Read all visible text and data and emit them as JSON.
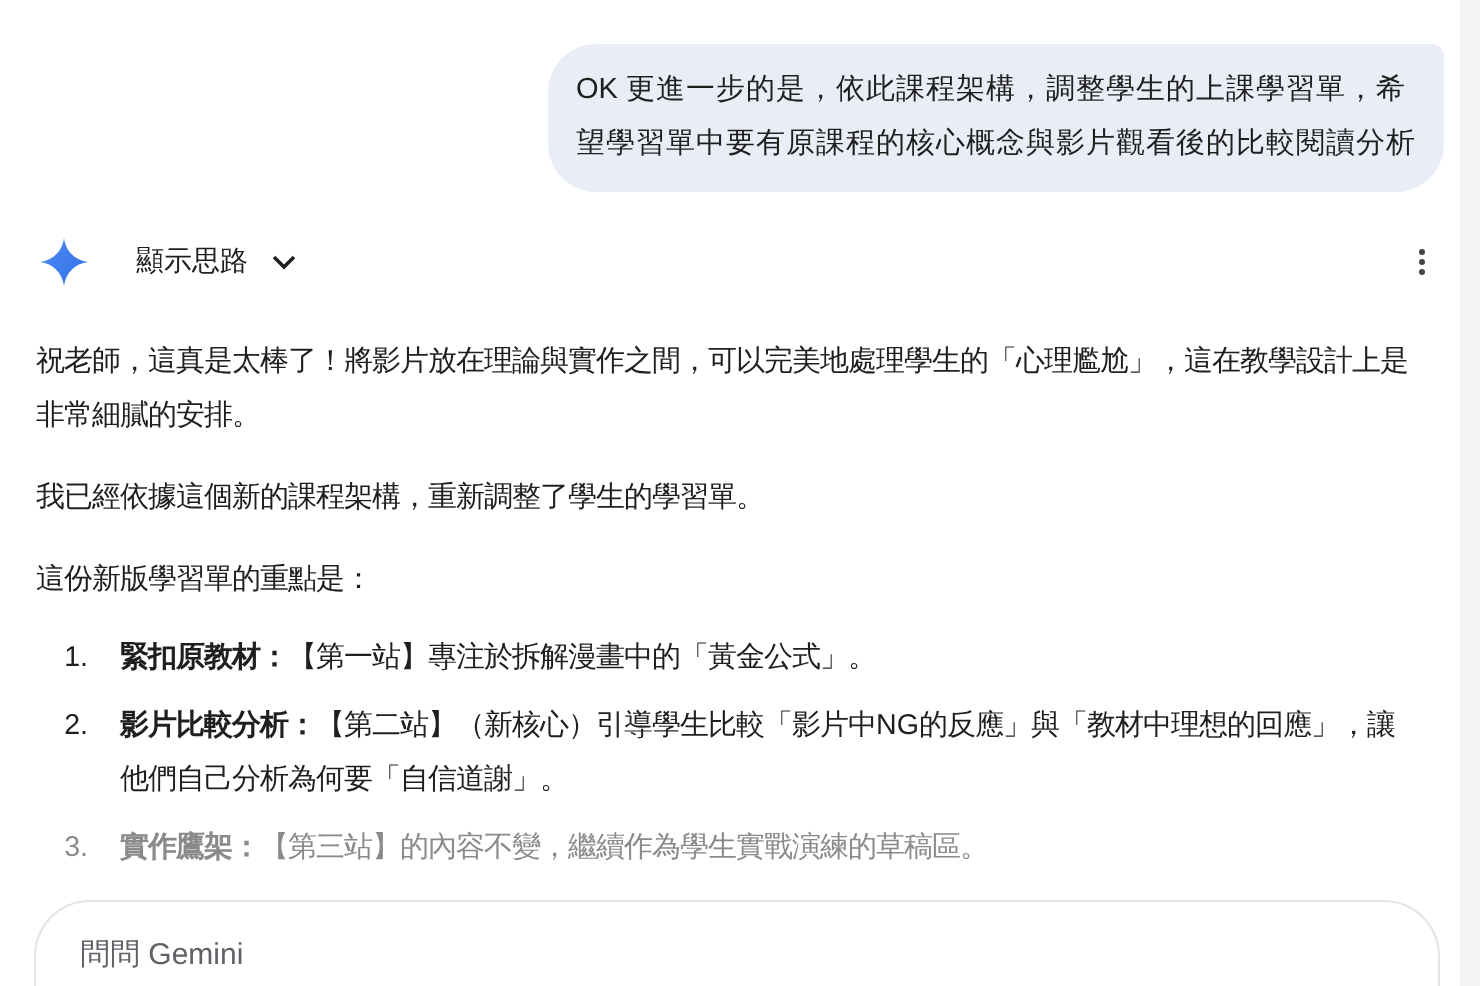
{
  "user_message": "OK 更進一步的是，依此課程架構，調整學生的上課學習單，希望學習單中要有原課程的核心概念與影片觀看後的比較閱讀分析",
  "response_header": {
    "label": "顯示思路",
    "expanded": false
  },
  "paragraphs": [
    "祝老師，這真是太棒了！將影片放在理論與實作之間，可以完美地處理學生的「心理尷尬」，這在教學設計上是非常細膩的安排。",
    "我已經依據這個新的課程架構，重新調整了學生的學習單。",
    "這份新版學習單的重點是："
  ],
  "list": [
    {
      "number": "1.",
      "text": "**緊扣原教材：**【第一站】專注於拆解漫畫中的「黃金公式」。",
      "faded": false
    },
    {
      "number": "2.",
      "text": "**影片比較分析：**【第二站】（新核心）引導學生比較「影片中NG的反應」與「教材中理想的回應」，讓他們自己分析為何要「自信道謝」。",
      "faded": false
    },
    {
      "number": "3.",
      "text": "**實作鷹架：**【第三站】的內容不變，繼續作為學生實戰演練的草稿區。",
      "faded": true
    }
  ],
  "input": {
    "placeholder": "問問 Gemini"
  }
}
